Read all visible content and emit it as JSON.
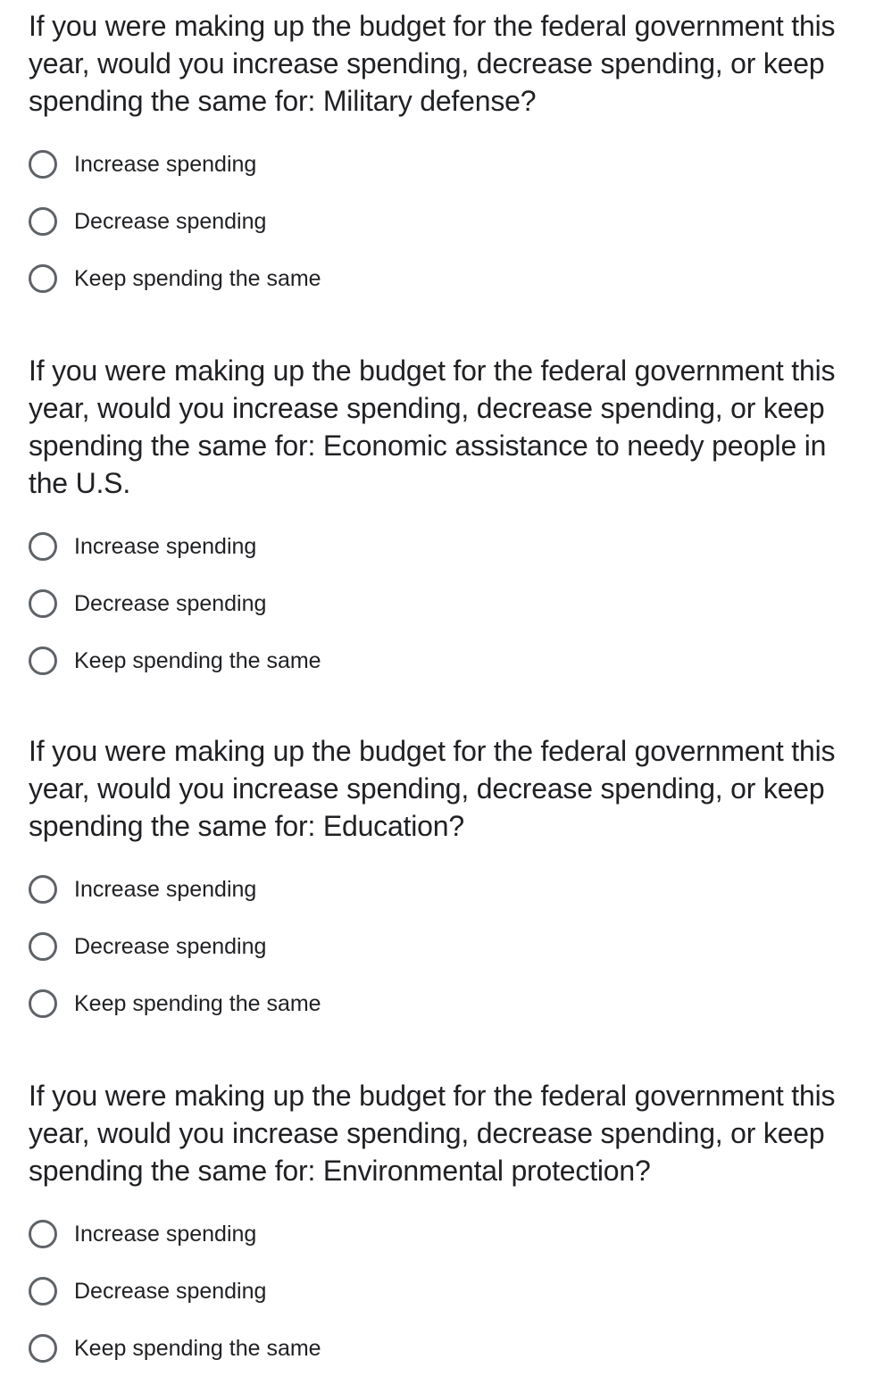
{
  "questions": [
    {
      "title": "If you were making up the budget for the federal government this year, would you increase spending, decrease spending, or keep spending the same for: Military defense?",
      "options": [
        "Increase spending",
        "Decrease spending",
        "Keep spending the same"
      ]
    },
    {
      "title": "If you were making up the budget for the federal government this year, would you increase spending, decrease spending, or keep spending the same for: Economic assistance to needy people in the U.S.",
      "options": [
        "Increase spending",
        "Decrease spending",
        "Keep spending the same"
      ]
    },
    {
      "title": "If you were making up the budget for the federal government this year, would you increase spending, decrease spending, or keep spending the same for: Education?",
      "options": [
        "Increase spending",
        "Decrease spending",
        "Keep spending the same"
      ]
    },
    {
      "title": "If you were making up the budget for the federal government this year, would you increase spending, decrease spending, or keep spending the same for: Environmental protection?",
      "options": [
        "Increase spending",
        "Decrease spending",
        "Keep spending the same"
      ]
    }
  ]
}
